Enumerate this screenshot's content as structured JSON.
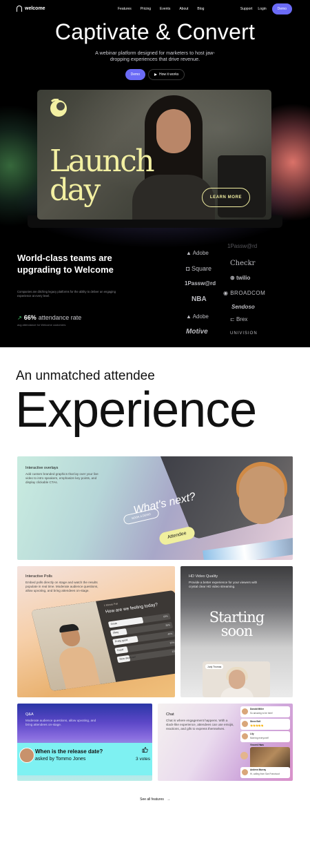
{
  "nav": {
    "logo_text": "welcome",
    "links": [
      "Features",
      "Pricing",
      "Events",
      "About",
      "Blog"
    ],
    "support": "Support",
    "login": "Login",
    "demo": "Demo"
  },
  "hero": {
    "title": "Captivate & Convert",
    "subtitle": "A webinar platform designed for marketers to host jaw-dropping experiences that drive revenue.",
    "demo_button": "Demo",
    "how_button": "How it works",
    "video": {
      "overlay_line1": "Launch",
      "overlay_line2": "day",
      "cta": "LEARN MORE"
    },
    "colors": {
      "accent": "#6b6bf6",
      "overlay_yellow": "#f3f0a2"
    }
  },
  "teams": {
    "title": "World-class teams are upgrading to Welcome",
    "subtitle": "Companies are ditching legacy platforms for the ability to deliver an engaging experience at every level.",
    "stat_value": "66%",
    "stat_label": "attendance rate",
    "stat_note": "avg attendance for Welcome customers",
    "logos_left": [
      "Adobe",
      "Square",
      "1Passw@rd",
      "NBA",
      "Adobe",
      "Motive"
    ],
    "logos_right": [
      "1Passw@rd",
      "Checkr",
      "twilio",
      "BROADCOM",
      "Sendoso",
      "Brex",
      "UNIVISION"
    ]
  },
  "experience": {
    "subtitle": "An unmatched attendee",
    "title": "Experience"
  },
  "features": {
    "overlays": {
      "title": "Interactive overlays",
      "desc": "Add custom branded graphics that lay over your live video to intro speakers, emphasize key points, and display clickable CTAs.",
      "screen_text": "What's next?",
      "book_demo": "BOOK A DEMO",
      "attendee": "Attendee"
    },
    "polls": {
      "title": "Interactive Polls",
      "desc": "Embed polls directly on stage and watch the results populate in real time. Moderate audience questions, allow upvoting, and bring attendees on-stage.",
      "poll_label": "1 Minute Poll",
      "question": "How are we feeling today?",
      "options": [
        {
          "label": "Great",
          "percent": 55
        },
        {
          "label": "Okay",
          "percent": 25
        },
        {
          "label": "Pretty good",
          "percent": 40
        },
        {
          "label": "Good",
          "percent": 20
        },
        {
          "label": "Slow day-ever!",
          "percent": 10
        }
      ]
    },
    "hd": {
      "title": "HD Video Quality",
      "desc": "Provide a better experience for your viewers with crystal clear HD video streaming.",
      "screen_line1": "Starting",
      "screen_line2": "soon",
      "tile_name": "Judy Thomas"
    },
    "qa": {
      "title": "Q&A",
      "desc": "Moderate audience questions, allow upvoting, and bring attendees on-stage.",
      "question": "When is the release date?",
      "asked_by": "asked by Tommo Jones",
      "votes": "3 votes"
    },
    "chat": {
      "title": "Chat",
      "desc": "Chat is where engagement happens. With a slack-like experience, attendees can use emojis, reactions, and gifs to express themselves.",
      "messages": [
        {
          "name": "Donald Miller",
          "text": "So amazing to be here!"
        },
        {
          "name": "Steve Bell",
          "text": "👏👏👏👏👏"
        },
        {
          "name": "Lily",
          "text": "Morning everyone!!"
        },
        {
          "name": "Vincent Haas",
          "text": ""
        },
        {
          "name": "Andrew Murray",
          "text": "Hi, calling from San Francisco!"
        }
      ]
    },
    "see_all": "See all features"
  }
}
